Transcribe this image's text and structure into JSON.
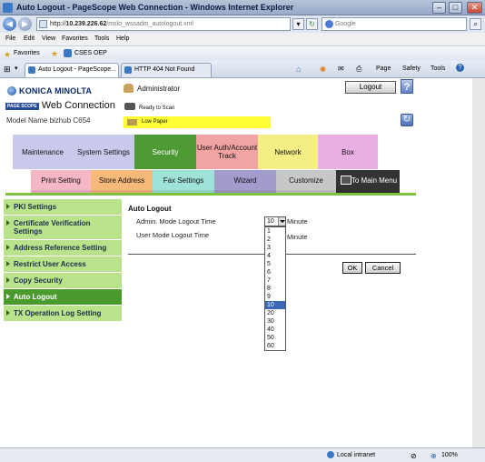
{
  "window": {
    "title": "Auto Logout - PageScope Web Connection - Windows Internet Explorer"
  },
  "address_bar": {
    "url_prefix": "http://",
    "url_host": "10.239.226.62",
    "url_path": "/mslo_wssadm_autologout.xml",
    "search_placeholder": "Google"
  },
  "menu": [
    "File",
    "Edit",
    "View",
    "Favorites",
    "Tools",
    "Help"
  ],
  "favorites": {
    "label": "Favorites",
    "link": "CSES OEP"
  },
  "tabs": [
    "Auto Logout - PageScope...",
    "HTTP 404 Not Found"
  ],
  "ie_toolbar": [
    "Page",
    "Safety",
    "Tools"
  ],
  "header": {
    "brand": "KONICA MINOLTA",
    "product_badge": "PAGE SCOPE",
    "product": "Web Connection",
    "model": "Model Name bizhub C654",
    "user": "Administrator",
    "logout": "Logout",
    "help": "?",
    "status_ready": "Ready to Scan",
    "status_paper": "Low Paper"
  },
  "categories_row1": [
    {
      "label": "Maintenance",
      "color": "#c9c9ec"
    },
    {
      "label": "System Settings",
      "color": "#c9c9ec"
    },
    {
      "label": "Security",
      "color": "#4d9a34"
    },
    {
      "label": "User Auth/Account Track",
      "color": "#f2a3a3"
    },
    {
      "label": "Network",
      "color": "#f4ee84"
    },
    {
      "label": "Box",
      "color": "#e9aee2"
    }
  ],
  "categories_row2": [
    {
      "label": "Print Setting",
      "color": "#f5b6c6"
    },
    {
      "label": "Store Address",
      "color": "#f6b97a"
    },
    {
      "label": "Fax Settings",
      "color": "#9fe2d7"
    },
    {
      "label": "Wizard",
      "color": "#a19ccc"
    },
    {
      "label": "Customize",
      "color": "#c7c7c7"
    },
    {
      "label": "To Main Menu",
      "color": "#333333"
    }
  ],
  "sidebar": [
    {
      "label": "PKI Settings",
      "active": false
    },
    {
      "label": "Certificate Verification Settings",
      "active": false
    },
    {
      "label": "Address Reference Setting",
      "active": false
    },
    {
      "label": "Restrict User Access",
      "active": false
    },
    {
      "label": "Copy Security",
      "active": false
    },
    {
      "label": "Auto Logout",
      "active": true
    },
    {
      "label": "TX Operation Log Setting",
      "active": false
    }
  ],
  "main": {
    "title": "Auto Logout",
    "admin_label": "Admin. Mode Logout Time",
    "admin_value": "10",
    "user_label": "User Mode Logout Time",
    "unit": "Minute",
    "options": [
      "1",
      "2",
      "3",
      "4",
      "5",
      "6",
      "7",
      "8",
      "9",
      "10",
      "20",
      "30",
      "40",
      "50",
      "60"
    ],
    "selected_option": "10",
    "ok": "OK",
    "cancel": "Cancel"
  },
  "statusbar": {
    "zone": "Local intranet",
    "zoom": "100%"
  }
}
